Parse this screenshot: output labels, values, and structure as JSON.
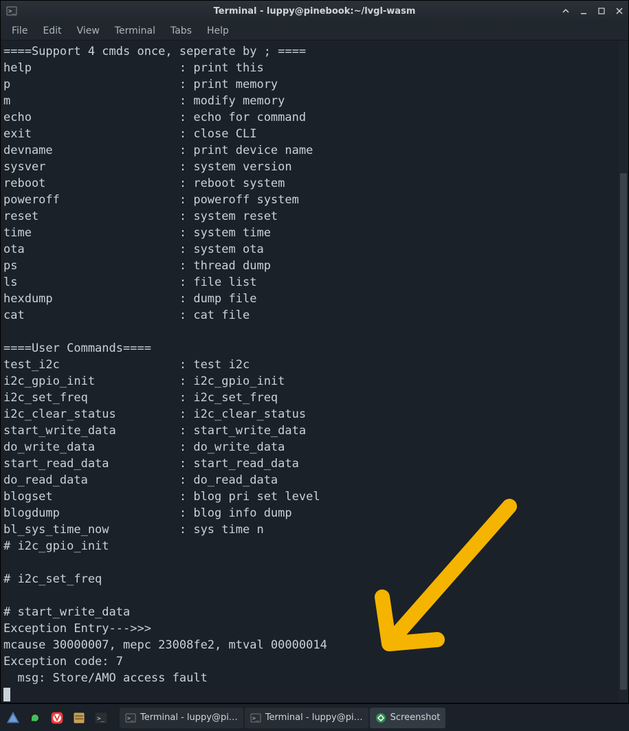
{
  "window": {
    "title": "Terminal - luppy@pinebook:~/lvgl-wasm",
    "app_icon": "terminal-icon"
  },
  "menu": {
    "file": "File",
    "edit": "Edit",
    "view": "View",
    "terminal": "Terminal",
    "tabs": "Tabs",
    "help": "Help"
  },
  "terminal": {
    "lines": [
      "====Support 4 cmds once, seperate by ; ====",
      "help                     : print this",
      "p                        : print memory",
      "m                        : modify memory",
      "echo                     : echo for command",
      "exit                     : close CLI",
      "devname                  : print device name",
      "sysver                   : system version",
      "reboot                   : reboot system",
      "poweroff                 : poweroff system",
      "reset                    : system reset",
      "time                     : system time",
      "ota                      : system ota",
      "ps                       : thread dump",
      "ls                       : file list",
      "hexdump                  : dump file",
      "cat                      : cat file",
      "",
      "====User Commands====",
      "test_i2c                 : test i2c",
      "i2c_gpio_init            : i2c_gpio_init",
      "i2c_set_freq             : i2c_set_freq",
      "i2c_clear_status         : i2c_clear_status",
      "start_write_data         : start_write_data",
      "do_write_data            : do_write_data",
      "start_read_data          : start_read_data",
      "do_read_data             : do_read_data",
      "blogset                  : blog pri set level",
      "blogdump                 : blog info dump",
      "bl_sys_time_now          : sys time n",
      "# i2c_gpio_init",
      "",
      "# i2c_set_freq",
      "",
      "# start_write_data",
      "Exception Entry--->>>",
      "mcause 30000007, mepc 23008fe2, mtval 00000014",
      "Exception code: 7",
      "  msg: Store/AMO access fault"
    ]
  },
  "taskbar": {
    "items": [
      {
        "label": "Terminal - luppy@pi…"
      },
      {
        "label": "Terminal - luppy@pi…"
      },
      {
        "label": "Screenshot",
        "active": true
      }
    ]
  },
  "annotation": {
    "arrow_color": "#f5b400"
  }
}
